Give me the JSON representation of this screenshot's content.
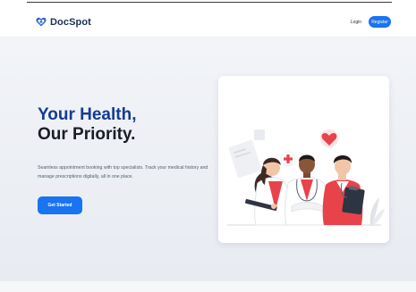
{
  "brand": {
    "name": "DocSpot",
    "icon": "heart-shield-icon",
    "color": "#1c2f55"
  },
  "nav": {
    "login_label": "Login",
    "register_label": "Register"
  },
  "hero": {
    "title_line1": "Your Health,",
    "title_line2": "Our Priority.",
    "description": "Seamless appointment booking with top specialists. Track your medical history and manage prescriptions digitally, all in one place.",
    "cta_label": "Get Started",
    "illustration": "medical-team-illustration"
  },
  "colors": {
    "accent": "#1a73f0",
    "title_blue": "#143c8f",
    "title_dark": "#1a1d24",
    "medical_red": "#e8434b"
  }
}
